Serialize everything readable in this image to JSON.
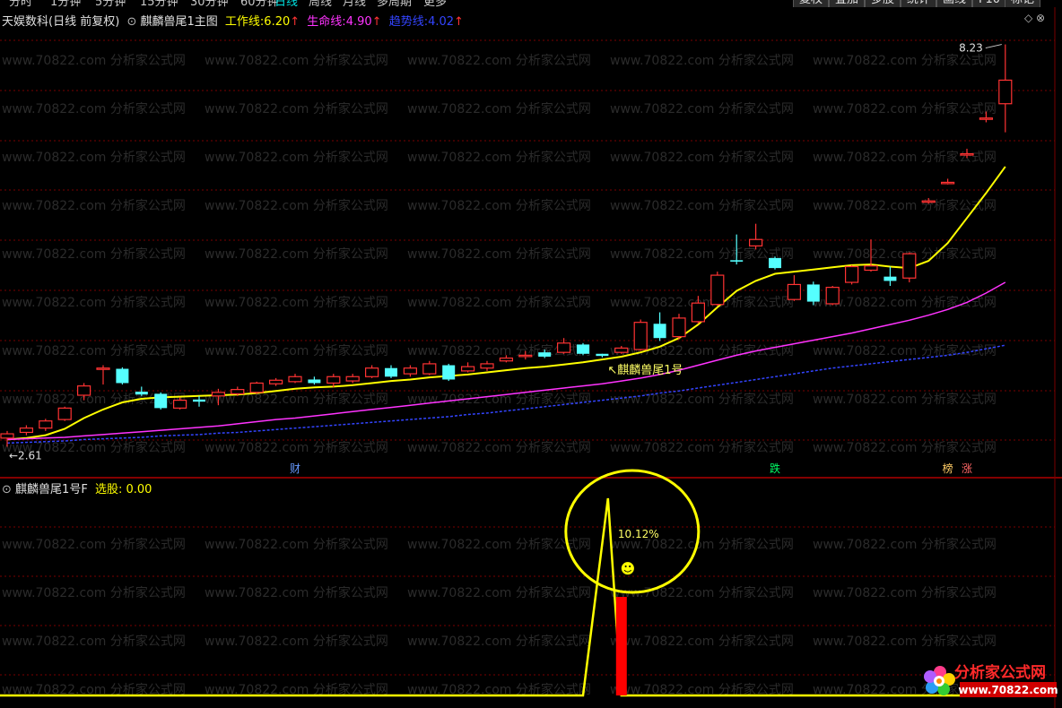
{
  "topbar": {
    "period_tabs": [
      "分时",
      "1分钟",
      "5分钟",
      "15分钟",
      "30分钟",
      "60分钟",
      "日线",
      "周线",
      "月线",
      "多周期",
      "更多"
    ],
    "active_tab": "日线",
    "buttons": [
      "复权",
      "叠加",
      "多股",
      "统计",
      "画线",
      "F10",
      "标记"
    ]
  },
  "main_header": {
    "stock": "天娱数科",
    "mode": "(日线 前复权)",
    "indicator": "麒麟兽尾1主图",
    "lines": [
      {
        "label": "工作线:",
        "value": "6.20",
        "color": "#ffff00",
        "arrow": "↑"
      },
      {
        "label": "生命线:",
        "value": "4.90",
        "color": "#ff33ff",
        "arrow": "↑"
      },
      {
        "label": "趋势线:",
        "value": "4.02",
        "color": "#3344ff",
        "arrow": "↑"
      }
    ]
  },
  "sub_header": {
    "indicator": "麒麟兽尾1号F",
    "label": "选股:",
    "value": "0.00"
  },
  "annotations": {
    "high_price": "8.23",
    "low_price": "2.61",
    "signal_label": "麒麟兽尾1号",
    "circle_value": "10.12%",
    "smiley": "☻"
  },
  "event_markers": [
    {
      "text": "财",
      "color": "#6699ff"
    },
    {
      "text": "跌",
      "color": "#00ff66"
    },
    {
      "text": "榜",
      "color": "#ffcc66"
    },
    {
      "text": "涨",
      "color": "#ff6666"
    }
  ],
  "watermark_text": "www.70822.com 分析家公式网",
  "logo": {
    "title": "分析家公式网",
    "url": "www.70822.com"
  },
  "colors": {
    "up_candle": "#ff3333",
    "down_candle": "#55ffff",
    "work_line": "#ffff00",
    "life_line": "#ff33ff",
    "trend_line": "#3344ff",
    "grid": "#7a0000",
    "signal_bar": "#ff0000"
  },
  "chart_data": [
    {
      "type": "candlestick",
      "title": "麒麟兽尾1主图",
      "ylim": [
        2.5,
        8.5
      ],
      "candles": [
        {
          "o": 2.72,
          "c": 2.78,
          "h": 2.82,
          "l": 2.6
        },
        {
          "o": 2.8,
          "c": 2.86,
          "h": 2.9,
          "l": 2.76
        },
        {
          "o": 2.86,
          "c": 2.96,
          "h": 2.99,
          "l": 2.82
        },
        {
          "o": 2.98,
          "c": 3.14,
          "h": 3.16,
          "l": 2.96
        },
        {
          "o": 3.32,
          "c": 3.45,
          "h": 3.49,
          "l": 3.25
        },
        {
          "o": 3.7,
          "c": 3.7,
          "h": 3.74,
          "l": 3.47
        },
        {
          "o": 3.69,
          "c": 3.49,
          "h": 3.71,
          "l": 3.47
        },
        {
          "o": 3.37,
          "c": 3.33,
          "h": 3.44,
          "l": 3.31
        },
        {
          "o": 3.34,
          "c": 3.14,
          "h": 3.36,
          "l": 3.12
        },
        {
          "o": 3.14,
          "c": 3.25,
          "h": 3.29,
          "l": 3.12
        },
        {
          "o": 3.26,
          "c": 3.23,
          "h": 3.31,
          "l": 3.16
        },
        {
          "o": 3.31,
          "c": 3.36,
          "h": 3.41,
          "l": 3.18
        },
        {
          "o": 3.34,
          "c": 3.4,
          "h": 3.44,
          "l": 3.31
        },
        {
          "o": 3.36,
          "c": 3.49,
          "h": 3.51,
          "l": 3.34
        },
        {
          "o": 3.48,
          "c": 3.53,
          "h": 3.56,
          "l": 3.45
        },
        {
          "o": 3.51,
          "c": 3.58,
          "h": 3.62,
          "l": 3.49
        },
        {
          "o": 3.54,
          "c": 3.49,
          "h": 3.58,
          "l": 3.47
        },
        {
          "o": 3.49,
          "c": 3.58,
          "h": 3.62,
          "l": 3.43
        },
        {
          "o": 3.52,
          "c": 3.58,
          "h": 3.62,
          "l": 3.49
        },
        {
          "o": 3.58,
          "c": 3.7,
          "h": 3.74,
          "l": 3.56
        },
        {
          "o": 3.7,
          "c": 3.58,
          "h": 3.74,
          "l": 3.56
        },
        {
          "o": 3.62,
          "c": 3.7,
          "h": 3.74,
          "l": 3.58
        },
        {
          "o": 3.62,
          "c": 3.76,
          "h": 3.8,
          "l": 3.6
        },
        {
          "o": 3.74,
          "c": 3.54,
          "h": 3.76,
          "l": 3.52
        },
        {
          "o": 3.66,
          "c": 3.72,
          "h": 3.78,
          "l": 3.64
        },
        {
          "o": 3.7,
          "c": 3.76,
          "h": 3.8,
          "l": 3.66
        },
        {
          "o": 3.8,
          "c": 3.84,
          "h": 3.88,
          "l": 3.78
        },
        {
          "o": 3.88,
          "c": 3.88,
          "h": 3.94,
          "l": 3.82
        },
        {
          "o": 3.92,
          "c": 3.86,
          "h": 3.96,
          "l": 3.84
        },
        {
          "o": 3.92,
          "c": 4.05,
          "h": 4.12,
          "l": 3.9
        },
        {
          "o": 4.03,
          "c": 3.9,
          "h": 4.05,
          "l": 3.88
        },
        {
          "o": 3.9,
          "c": 3.87,
          "h": 3.9,
          "l": 3.85
        },
        {
          "o": 3.92,
          "c": 3.98,
          "h": 4.01,
          "l": 3.9
        },
        {
          "o": 3.96,
          "c": 4.34,
          "h": 4.38,
          "l": 3.94
        },
        {
          "o": 4.32,
          "c": 4.12,
          "h": 4.48,
          "l": 4.08
        },
        {
          "o": 4.14,
          "c": 4.4,
          "h": 4.46,
          "l": 4.1
        },
        {
          "o": 4.35,
          "c": 4.61,
          "h": 4.71,
          "l": 4.32
        },
        {
          "o": 4.59,
          "c": 5.0,
          "h": 5.05,
          "l": 4.57
        },
        {
          "o": 5.21,
          "c": 5.19,
          "h": 5.57,
          "l": 5.15
        },
        {
          "o": 5.41,
          "c": 5.5,
          "h": 5.72,
          "l": 5.36
        },
        {
          "o": 5.24,
          "c": 5.1,
          "h": 5.26,
          "l": 5.08
        },
        {
          "o": 4.66,
          "c": 4.87,
          "h": 5.0,
          "l": 4.64
        },
        {
          "o": 4.87,
          "c": 4.63,
          "h": 4.91,
          "l": 4.58
        },
        {
          "o": 4.6,
          "c": 4.83,
          "h": 4.85,
          "l": 4.58
        },
        {
          "o": 4.9,
          "c": 5.12,
          "h": 5.14,
          "l": 4.87
        },
        {
          "o": 5.07,
          "c": 5.13,
          "h": 5.5,
          "l": 5.05
        },
        {
          "o": 4.98,
          "c": 4.92,
          "h": 5.12,
          "l": 4.85
        },
        {
          "o": 4.96,
          "c": 5.3,
          "h": 5.32,
          "l": 4.9
        },
        {
          "o": 6.04,
          "c": 6.04,
          "h": 6.08,
          "l": 6.0
        },
        {
          "o": 6.3,
          "c": 6.3,
          "h": 6.35,
          "l": 6.27
        },
        {
          "o": 6.7,
          "c": 6.7,
          "h": 6.77,
          "l": 6.64
        },
        {
          "o": 7.2,
          "c": 7.2,
          "h": 7.29,
          "l": 7.14
        },
        {
          "o": 7.4,
          "c": 7.73,
          "h": 8.23,
          "l": 7.0
        }
      ],
      "series": [
        {
          "name": "工作线",
          "values": [
            2.7,
            2.72,
            2.76,
            2.85,
            3.0,
            3.12,
            3.22,
            3.27,
            3.29,
            3.3,
            3.31,
            3.32,
            3.33,
            3.35,
            3.38,
            3.41,
            3.43,
            3.44,
            3.46,
            3.49,
            3.52,
            3.54,
            3.57,
            3.59,
            3.61,
            3.64,
            3.67,
            3.7,
            3.72,
            3.75,
            3.78,
            3.82,
            3.86,
            3.92,
            4.0,
            4.12,
            4.31,
            4.55,
            4.78,
            4.92,
            5.02,
            5.05,
            5.08,
            5.11,
            5.14,
            5.15,
            5.12,
            5.1,
            5.2,
            5.45,
            5.8,
            6.15,
            6.52
          ]
        },
        {
          "name": "生命线",
          "values": [
            2.7,
            2.71,
            2.72,
            2.73,
            2.75,
            2.77,
            2.79,
            2.81,
            2.83,
            2.85,
            2.87,
            2.89,
            2.92,
            2.95,
            2.98,
            3.0,
            3.03,
            3.06,
            3.09,
            3.12,
            3.15,
            3.18,
            3.21,
            3.24,
            3.27,
            3.3,
            3.33,
            3.36,
            3.39,
            3.42,
            3.45,
            3.48,
            3.52,
            3.56,
            3.61,
            3.67,
            3.74,
            3.81,
            3.88,
            3.94,
            3.99,
            4.04,
            4.09,
            4.14,
            4.19,
            4.25,
            4.31,
            4.37,
            4.44,
            4.52,
            4.62,
            4.75,
            4.9
          ]
        },
        {
          "name": "趋势线",
          "values": [
            2.65,
            2.66,
            2.67,
            2.68,
            2.7,
            2.71,
            2.72,
            2.73,
            2.75,
            2.76,
            2.77,
            2.79,
            2.8,
            2.82,
            2.84,
            2.86,
            2.88,
            2.9,
            2.92,
            2.94,
            2.96,
            2.98,
            3.0,
            3.02,
            3.05,
            3.07,
            3.1,
            3.13,
            3.16,
            3.19,
            3.22,
            3.25,
            3.28,
            3.31,
            3.35,
            3.38,
            3.42,
            3.46,
            3.5,
            3.54,
            3.58,
            3.62,
            3.66,
            3.7,
            3.73,
            3.76,
            3.79,
            3.82,
            3.85,
            3.88,
            3.92,
            3.97,
            4.02
          ]
        }
      ]
    },
    {
      "type": "line",
      "title": "麒麟兽尾1号F",
      "series": [
        {
          "name": "选股",
          "values": [
            0,
            0,
            0,
            0,
            0,
            0,
            0,
            0,
            0,
            0,
            0,
            0,
            0,
            0,
            0,
            0,
            0,
            0,
            0,
            0,
            0,
            0,
            0,
            0,
            0,
            0,
            0,
            0,
            0,
            0,
            0,
            0,
            0,
            0,
            0,
            0,
            0,
            0,
            0,
            0,
            0,
            0,
            0,
            0,
            0,
            0,
            0,
            0,
            0,
            0,
            0,
            0,
            0
          ]
        }
      ]
    }
  ]
}
